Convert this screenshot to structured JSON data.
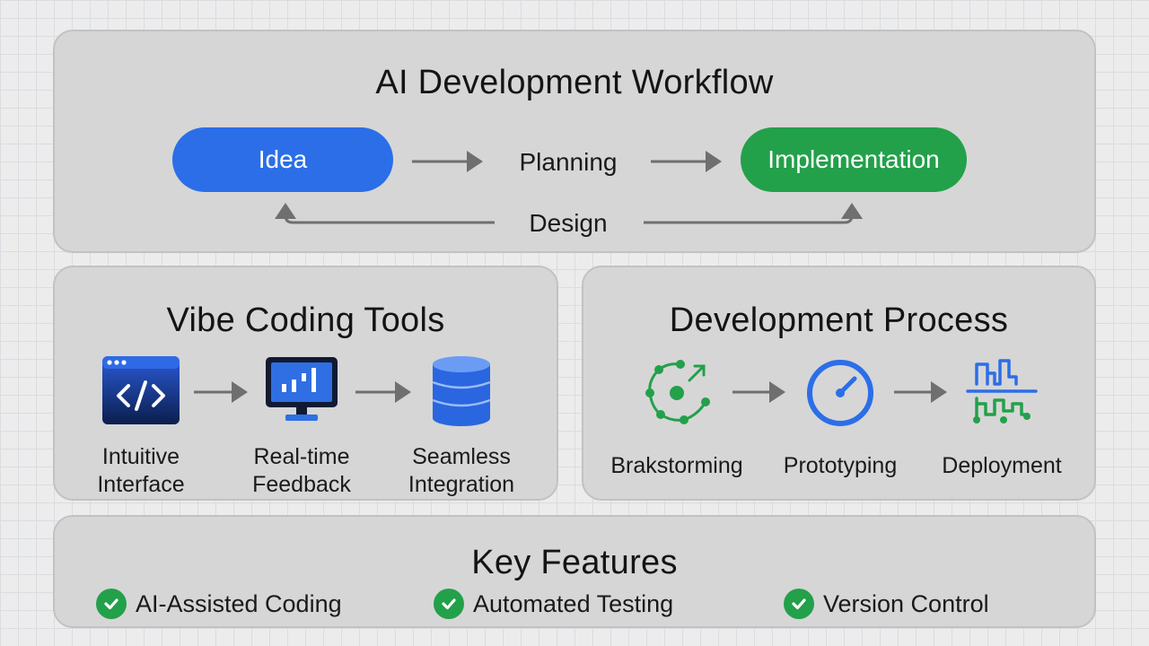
{
  "colors": {
    "blue": "#2b6ee8",
    "green": "#23a04a",
    "arrow": "#6f6f6f",
    "panel": "#d6d6d6"
  },
  "workflow": {
    "title": "AI Development Workflow",
    "nodes": {
      "idea": "Idea",
      "planning": "Planning",
      "implementation": "Implementation",
      "design": "Design"
    }
  },
  "tools": {
    "title": "Vibe Coding Tools",
    "items": [
      {
        "icon": "code-window-icon",
        "line1": "Intuitive",
        "line2": "Interface"
      },
      {
        "icon": "monitor-chart-icon",
        "line1": "Real-time",
        "line2": "Feedback"
      },
      {
        "icon": "database-icon",
        "line1": "Seamless",
        "line2": "Integration"
      }
    ]
  },
  "process": {
    "title": "Development Process",
    "items": [
      {
        "icon": "brainstorm-cycle-icon",
        "label": "Brakstorming"
      },
      {
        "icon": "gauge-icon",
        "label": "Prototyping"
      },
      {
        "icon": "signal-waves-icon",
        "label": "Deployment"
      }
    ]
  },
  "features": {
    "title": "Key Features",
    "items": [
      {
        "icon": "check-circle-icon",
        "label": "AI-Assisted Coding"
      },
      {
        "icon": "check-circle-icon",
        "label": "Automated Testing"
      },
      {
        "icon": "check-circle-icon",
        "label": "Version Control"
      }
    ]
  }
}
